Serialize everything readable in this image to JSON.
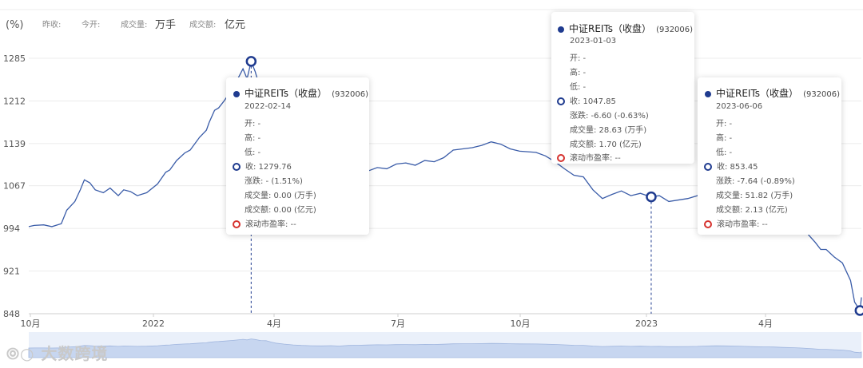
{
  "header": {
    "y_unit": "(%)",
    "prev_close_label": "昨收:",
    "open_label": "今开:",
    "volume_label": "成交量:",
    "volume_unit": "万手",
    "amount_label": "成交额:",
    "amount_unit": "亿元"
  },
  "watermark": "大数跨境",
  "colors": {
    "line": "#3a5ca8",
    "marker": "#1f3b8f",
    "pe_marker": "#d6322e",
    "grid": "#ececec",
    "navigator": "#dce6f7"
  },
  "tooltips": [
    {
      "name": "中证REITs（收盘）",
      "code": "(932006)",
      "date": "2022-02-14",
      "open": "开: -",
      "high": "高: -",
      "low": "低: -",
      "close": "收: 1279.76",
      "change": "涨跌: - (1.51%)",
      "volume": "成交量: 0.00 (万手)",
      "amount": "成交额: 0.00 (亿元)",
      "pe": "滚动市盈率: --"
    },
    {
      "name": "中证REITs（收盘）",
      "code": "(932006)",
      "date": "2023-01-03",
      "open": "开: -",
      "high": "高: -",
      "low": "低: -",
      "close": "收: 1047.85",
      "change": "涨跌: -6.60 (-0.63%)",
      "volume": "成交量: 28.63 (万手)",
      "amount": "成交额: 1.70 (亿元)",
      "pe": "滚动市盈率: --"
    },
    {
      "name": "中证REITs（收盘）",
      "code": "(932006)",
      "date": "2023-06-06",
      "open": "开: -",
      "high": "高: -",
      "low": "低: -",
      "close": "收: 853.45",
      "change": "涨跌: -7.64 (-0.89%)",
      "volume": "成交量: 51.82 (万手)",
      "amount": "成交额: 2.13 (亿元)",
      "pe": "滚动市盈率: --"
    }
  ],
  "chart_data": {
    "type": "line",
    "title": "",
    "series": [
      {
        "name": "中证REITs（收盘）",
        "code": "932006"
      }
    ],
    "y_ticks": [
      1285,
      1212,
      1139,
      1067,
      994,
      921,
      848
    ],
    "ylim": [
      848,
      1285
    ],
    "x_ticks": [
      "10月",
      "2022",
      "4月",
      "7月",
      "10月",
      "2023",
      "4月"
    ],
    "x_range": [
      "2021-10-01",
      "2023-06-07"
    ],
    "points": [
      [
        "2021-10-01",
        997
      ],
      [
        "2021-10-05",
        999
      ],
      [
        "2021-10-12",
        1000
      ],
      [
        "2021-10-18",
        997
      ],
      [
        "2021-10-25",
        1002
      ],
      [
        "2021-10-29",
        1025
      ],
      [
        "2021-11-04",
        1040
      ],
      [
        "2021-11-08",
        1060
      ],
      [
        "2021-11-11",
        1077
      ],
      [
        "2021-11-15",
        1072
      ],
      [
        "2021-11-19",
        1060
      ],
      [
        "2021-11-25",
        1055
      ],
      [
        "2021-11-30",
        1063
      ],
      [
        "2021-12-06",
        1050
      ],
      [
        "2021-12-10",
        1060
      ],
      [
        "2021-12-15",
        1057
      ],
      [
        "2021-12-20",
        1050
      ],
      [
        "2021-12-27",
        1055
      ],
      [
        "2022-01-04",
        1070
      ],
      [
        "2022-01-10",
        1090
      ],
      [
        "2022-01-13",
        1094
      ],
      [
        "2022-01-18",
        1110
      ],
      [
        "2022-01-24",
        1123
      ],
      [
        "2022-01-28",
        1128
      ],
      [
        "2022-02-04",
        1150
      ],
      [
        "2022-02-09",
        1162
      ],
      [
        "2022-02-11",
        1175
      ],
      [
        "2022-02-15",
        1196
      ],
      [
        "2022-02-18",
        1200
      ],
      [
        "2022-02-22",
        1212
      ],
      [
        "2022-02-28",
        1232
      ],
      [
        "2022-03-03",
        1245
      ],
      [
        "2022-03-08",
        1267
      ],
      [
        "2022-03-11",
        1250
      ],
      [
        "2022-03-14",
        1279.76
      ],
      [
        "2022-03-17",
        1262
      ],
      [
        "2022-03-21",
        1230
      ],
      [
        "2022-03-25",
        1225
      ],
      [
        "2022-03-29",
        1180
      ],
      [
        "2022-04-01",
        1150
      ],
      [
        "2022-04-07",
        1120
      ],
      [
        "2022-04-14",
        1095
      ],
      [
        "2022-04-20",
        1080
      ],
      [
        "2022-04-27",
        1070
      ],
      [
        "2022-05-05",
        1065
      ],
      [
        "2022-05-12",
        1072
      ],
      [
        "2022-05-18",
        1060
      ],
      [
        "2022-05-25",
        1078
      ],
      [
        "2022-06-01",
        1085
      ],
      [
        "2022-06-08",
        1092
      ],
      [
        "2022-06-15",
        1098
      ],
      [
        "2022-06-22",
        1096
      ],
      [
        "2022-06-29",
        1104
      ],
      [
        "2022-07-06",
        1106
      ],
      [
        "2022-07-13",
        1102
      ],
      [
        "2022-07-20",
        1110
      ],
      [
        "2022-07-27",
        1108
      ],
      [
        "2022-08-03",
        1115
      ],
      [
        "2022-08-10",
        1128
      ],
      [
        "2022-08-17",
        1130
      ],
      [
        "2022-08-24",
        1132
      ],
      [
        "2022-08-31",
        1136
      ],
      [
        "2022-09-07",
        1142
      ],
      [
        "2022-09-14",
        1138
      ],
      [
        "2022-09-21",
        1130
      ],
      [
        "2022-09-28",
        1126
      ],
      [
        "2022-10-10",
        1124
      ],
      [
        "2022-10-17",
        1118
      ],
      [
        "2022-10-24",
        1108
      ],
      [
        "2022-10-31",
        1096
      ],
      [
        "2022-11-07",
        1085
      ],
      [
        "2022-11-14",
        1082
      ],
      [
        "2022-11-21",
        1060
      ],
      [
        "2022-11-28",
        1045
      ],
      [
        "2022-12-05",
        1052
      ],
      [
        "2022-12-12",
        1058
      ],
      [
        "2022-12-19",
        1050
      ],
      [
        "2022-12-26",
        1054
      ],
      [
        "2023-01-03",
        1047.85
      ],
      [
        "2023-01-09",
        1050
      ],
      [
        "2023-01-16",
        1040
      ],
      [
        "2023-01-30",
        1045
      ],
      [
        "2023-02-06",
        1050
      ],
      [
        "2023-02-13",
        1062
      ],
      [
        "2023-02-20",
        1066
      ],
      [
        "2023-02-27",
        1064
      ],
      [
        "2023-03-06",
        1058
      ],
      [
        "2023-03-13",
        1048
      ],
      [
        "2023-03-20",
        1040
      ],
      [
        "2023-03-27",
        1034
      ],
      [
        "2023-04-03",
        1030
      ],
      [
        "2023-04-10",
        1018
      ],
      [
        "2023-04-17",
        1010
      ],
      [
        "2023-04-24",
        996
      ],
      [
        "2023-05-04",
        970
      ],
      [
        "2023-05-08",
        958
      ],
      [
        "2023-05-12",
        958
      ],
      [
        "2023-05-18",
        945
      ],
      [
        "2023-05-24",
        935
      ],
      [
        "2023-05-30",
        905
      ],
      [
        "2023-06-02",
        868
      ],
      [
        "2023-06-06",
        853.45
      ],
      [
        "2023-06-07",
        876
      ]
    ],
    "highlight_dates": [
      "2022-03-14",
      "2023-01-03",
      "2023-06-06"
    ],
    "grid": true,
    "legend": "none"
  }
}
